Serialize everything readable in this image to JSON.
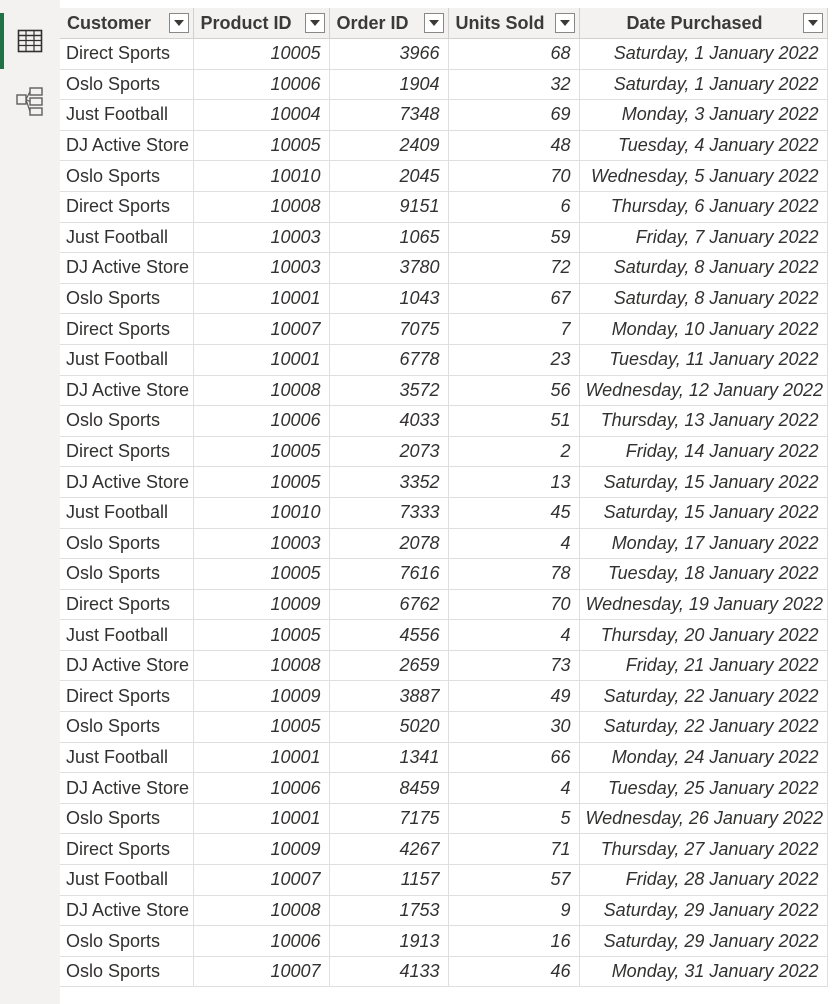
{
  "nav": {
    "items": [
      {
        "name": "table-view",
        "icon": "table-icon",
        "active": true
      },
      {
        "name": "model-view",
        "icon": "model-icon",
        "active": false
      }
    ]
  },
  "table": {
    "columns": [
      "Customer",
      "Product ID",
      "Order ID",
      "Units Sold",
      "Date Purchased"
    ],
    "rows": [
      [
        "Direct Sports",
        "10005",
        "3966",
        "68",
        "Saturday, 1 January 2022"
      ],
      [
        "Oslo Sports",
        "10006",
        "1904",
        "32",
        "Saturday, 1 January 2022"
      ],
      [
        "Just Football",
        "10004",
        "7348",
        "69",
        "Monday, 3 January 2022"
      ],
      [
        "DJ Active Store",
        "10005",
        "2409",
        "48",
        "Tuesday, 4 January 2022"
      ],
      [
        "Oslo Sports",
        "10010",
        "2045",
        "70",
        "Wednesday, 5 January 2022"
      ],
      [
        "Direct Sports",
        "10008",
        "9151",
        "6",
        "Thursday, 6 January 2022"
      ],
      [
        "Just Football",
        "10003",
        "1065",
        "59",
        "Friday, 7 January 2022"
      ],
      [
        "DJ Active Store",
        "10003",
        "3780",
        "72",
        "Saturday, 8 January 2022"
      ],
      [
        "Oslo Sports",
        "10001",
        "1043",
        "67",
        "Saturday, 8 January 2022"
      ],
      [
        "Direct Sports",
        "10007",
        "7075",
        "7",
        "Monday, 10 January 2022"
      ],
      [
        "Just Football",
        "10001",
        "6778",
        "23",
        "Tuesday, 11 January 2022"
      ],
      [
        "DJ Active Store",
        "10008",
        "3572",
        "56",
        "Wednesday, 12 January 2022"
      ],
      [
        "Oslo Sports",
        "10006",
        "4033",
        "51",
        "Thursday, 13 January 2022"
      ],
      [
        "Direct Sports",
        "10005",
        "2073",
        "2",
        "Friday, 14 January 2022"
      ],
      [
        "DJ Active Store",
        "10005",
        "3352",
        "13",
        "Saturday, 15 January 2022"
      ],
      [
        "Just Football",
        "10010",
        "7333",
        "45",
        "Saturday, 15 January 2022"
      ],
      [
        "Oslo Sports",
        "10003",
        "2078",
        "4",
        "Monday, 17 January 2022"
      ],
      [
        "Oslo Sports",
        "10005",
        "7616",
        "78",
        "Tuesday, 18 January 2022"
      ],
      [
        "Direct Sports",
        "10009",
        "6762",
        "70",
        "Wednesday, 19 January 2022"
      ],
      [
        "Just Football",
        "10005",
        "4556",
        "4",
        "Thursday, 20 January 2022"
      ],
      [
        "DJ Active Store",
        "10008",
        "2659",
        "73",
        "Friday, 21 January 2022"
      ],
      [
        "Direct Sports",
        "10009",
        "3887",
        "49",
        "Saturday, 22 January 2022"
      ],
      [
        "Oslo Sports",
        "10005",
        "5020",
        "30",
        "Saturday, 22 January 2022"
      ],
      [
        "Just Football",
        "10001",
        "1341",
        "66",
        "Monday, 24 January 2022"
      ],
      [
        "DJ Active Store",
        "10006",
        "8459",
        "4",
        "Tuesday, 25 January 2022"
      ],
      [
        "Oslo Sports",
        "10001",
        "7175",
        "5",
        "Wednesday, 26 January 2022"
      ],
      [
        "Direct Sports",
        "10009",
        "4267",
        "71",
        "Thursday, 27 January 2022"
      ],
      [
        "Just Football",
        "10007",
        "1157",
        "57",
        "Friday, 28 January 2022"
      ],
      [
        "DJ Active Store",
        "10008",
        "1753",
        "9",
        "Saturday, 29 January 2022"
      ],
      [
        "Oslo Sports",
        "10006",
        "1913",
        "16",
        "Saturday, 29 January 2022"
      ],
      [
        "Oslo Sports",
        "10007",
        "4133",
        "46",
        "Monday, 31 January 2022"
      ]
    ]
  },
  "colors": {
    "accent": "#217346",
    "header_bg": "#f3f2f1",
    "grid_line": "#e1dfdd"
  }
}
